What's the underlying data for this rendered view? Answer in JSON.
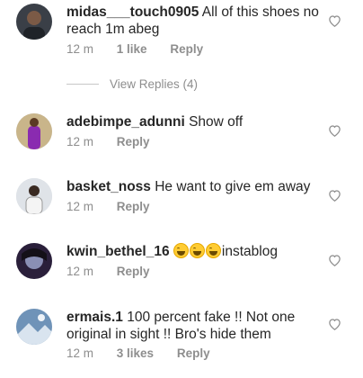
{
  "comments": [
    {
      "username": "midas___touch0905",
      "text": "All of this shoes no reach 1m abeg",
      "time": "12 m",
      "likes": "1 like",
      "reply": "Reply",
      "view_replies": "View Replies (4)"
    },
    {
      "username": "adebimpe_adunni",
      "text": "Show off",
      "time": "12 m",
      "reply": "Reply"
    },
    {
      "username": "basket_noss",
      "text": "He want to give em away",
      "time": "12 m",
      "reply": "Reply"
    },
    {
      "username": "kwin_bethel_16",
      "emojis": [
        "grinning-squinting-face",
        "grinning-squinting-face",
        "grinning-squinting-face"
      ],
      "text": "instablog",
      "time": "12 m",
      "reply": "Reply"
    },
    {
      "username": "ermais.1",
      "text": "100 percent fake !! Not one original in sight !! Bro's hide them",
      "time": "12 m",
      "likes": "3 likes",
      "reply": "Reply"
    }
  ],
  "icons": {
    "like": "heart-outline-icon"
  },
  "colors": {
    "text": "#262626",
    "meta": "#8e8e8e",
    "background": "#ffffff"
  }
}
